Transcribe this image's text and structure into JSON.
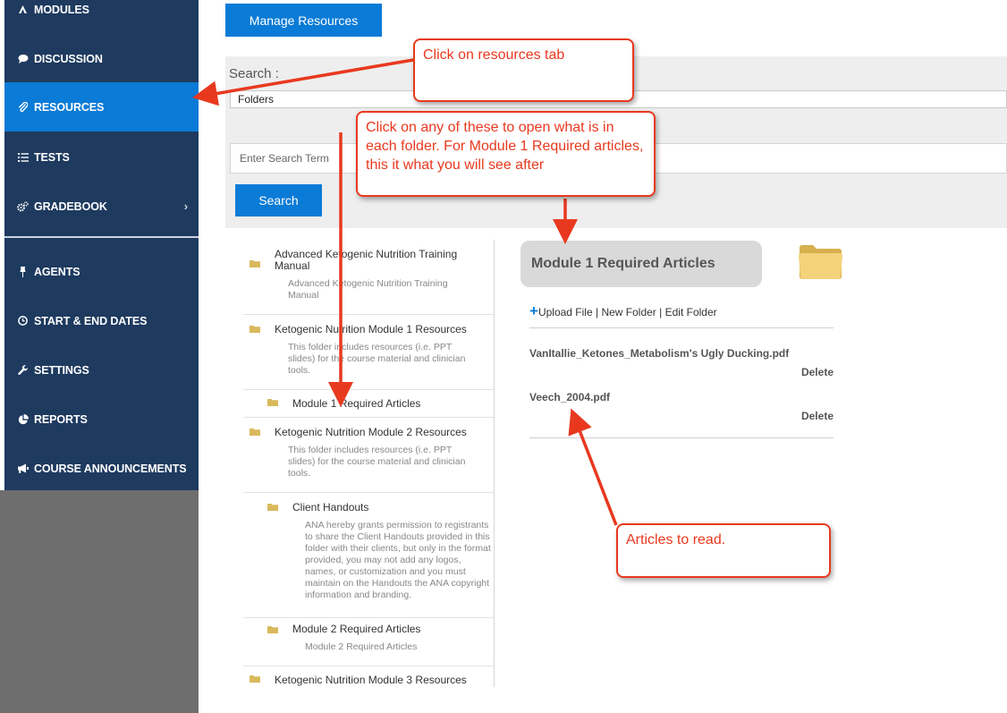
{
  "sidebar": {
    "items": [
      {
        "label": "MODULES",
        "icon": "modules-icon"
      },
      {
        "label": "DISCUSSION",
        "icon": "chat-icon"
      },
      {
        "label": "RESOURCES",
        "icon": "paperclip-icon"
      },
      {
        "label": "TESTS",
        "icon": "list-icon"
      },
      {
        "label": "GRADEBOOK",
        "icon": "gears-icon"
      },
      {
        "label": "AGENTS",
        "icon": "pin-icon"
      },
      {
        "label": "START & END DATES",
        "icon": "clock-icon"
      },
      {
        "label": "SETTINGS",
        "icon": "wrench-icon"
      },
      {
        "label": "REPORTS",
        "icon": "pie-chart-icon"
      },
      {
        "label": "COURSE ANNOUNCEMENTS",
        "icon": "megaphone-icon"
      }
    ],
    "gradebook_chevron": "›"
  },
  "manage_resources_label": "Manage Resources",
  "search": {
    "label": "Search :",
    "select_value": "Folders",
    "placeholder": "Enter Search Term",
    "button_label": "Search"
  },
  "tree": [
    {
      "title": "Advanced Ketogenic Nutrition Training Manual",
      "desc": "Advanced Ketogenic Nutrition Training Manual"
    },
    {
      "title": "Ketogenic Nutrition Module 1 Resources",
      "desc": "This folder includes resources (i.e. PPT slides) for the course material and clinician tools."
    },
    {
      "title": "Module 1 Required Articles",
      "desc": ""
    },
    {
      "title": "Ketogenic Nutrition Module 2 Resources",
      "desc": "This folder includes resources (i.e. PPT slides) for the course material and clinician tools."
    },
    {
      "title": "Client Handouts",
      "desc": "ANA hereby grants permission to registrants to share the Client Handouts provided in this folder with their clients, but only in the format provided, you may not add any logos, names, or customization and you must maintain on the Handouts the ANA copyright information and branding."
    },
    {
      "title": "Module 2 Required Articles",
      "desc": "Module 2 Required Articles"
    },
    {
      "title": "Ketogenic Nutrition Module 3 Resources",
      "desc": ""
    }
  ],
  "detail": {
    "title": "Module 1 Required Articles",
    "plus": "+",
    "upload_file": "Upload File",
    "separator": "|",
    "new_folder": "New Folder",
    "edit_folder": "Edit Folder",
    "files": [
      {
        "name": "VanItallie_Ketones_Metabolism's Ugly Ducking.pdf",
        "action": "Delete"
      },
      {
        "name": "Veech_2004.pdf",
        "action": "Delete"
      }
    ]
  },
  "callouts": {
    "resources_tab": "Click on resources tab",
    "folders": "Click on any of these to open what is in each folder.   For Module 1 Required articles, this it what you will see after",
    "articles": "Articles to read."
  },
  "colors": {
    "sidebar_bg": "#1e3a5f",
    "active_blue": "#0a7bd6",
    "annotation_red": "#e8391f"
  }
}
